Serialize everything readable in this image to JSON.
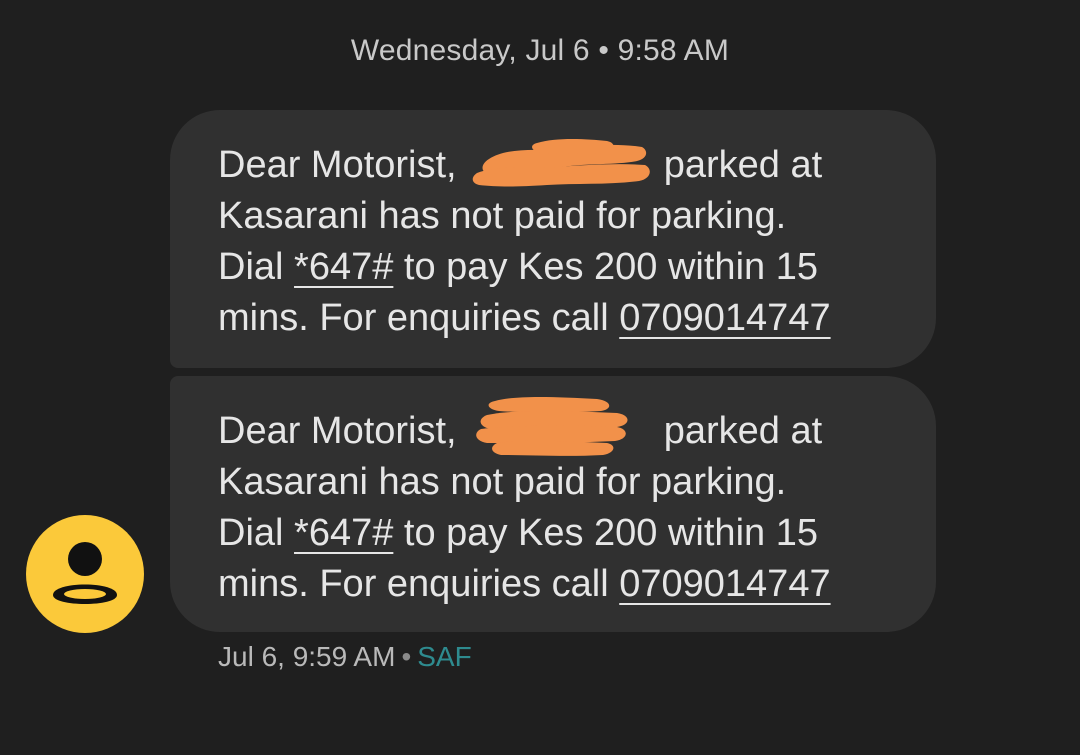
{
  "date_header": "Wednesday, Jul 6 • 9:58 AM",
  "messages": [
    {
      "line1_before": "Dear Motorist,",
      "line1_after": "parked at",
      "line2": "Kasarani has not paid for parking.",
      "line3_before": "Dial",
      "line3_code": "*647#",
      "line3_after": "to pay Kes 200 within 15",
      "line4_before": "mins. For enquiries call",
      "line4_phone": "0709014747"
    },
    {
      "line1_before": "Dear Motorist,",
      "line1_after": "parked at",
      "line2": "Kasarani has not paid for parking.",
      "line3_before": "Dial",
      "line3_code": "*647#",
      "line3_after": "to pay Kes 200 within 15",
      "line4_before": "mins. For enquiries call",
      "line4_phone": "0709014747"
    }
  ],
  "meta": {
    "time": "Jul 6, 9:59 AM",
    "separator": "•",
    "sender": "SAF"
  },
  "colors": {
    "background": "#1f1f1f",
    "bubble": "#303030",
    "redaction": "#f2914a",
    "avatar": "#fbc93a",
    "sender_accent": "#2e8b8f"
  },
  "icons": {
    "avatar": "person-icon",
    "redaction": "redaction-scribble"
  }
}
